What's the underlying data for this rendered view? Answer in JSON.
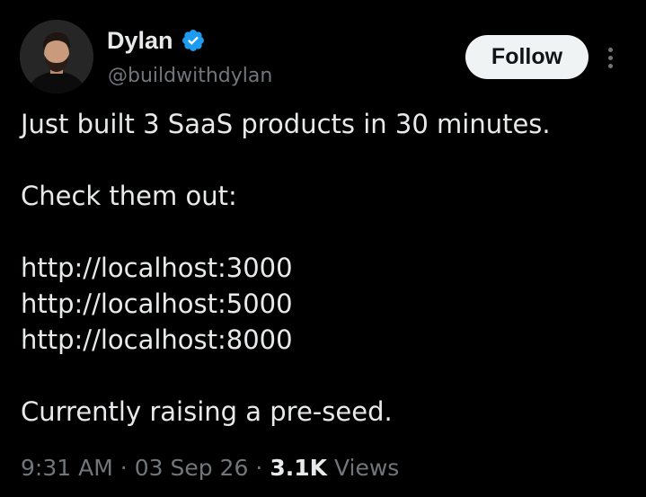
{
  "author": {
    "display_name": "Dylan",
    "handle": "@buildwithdylan",
    "verified": true,
    "verified_color": "#1d9bf0"
  },
  "actions": {
    "follow_label": "Follow",
    "more_icon": "more-vertical-icon"
  },
  "post": {
    "lines": [
      "Just built 3 SaaS products in 30 minutes.",
      "",
      "Check them out:",
      "",
      "http://localhost:3000",
      "http://localhost:5000",
      "http://localhost:8000",
      "",
      "Currently raising a pre-seed."
    ]
  },
  "meta": {
    "time": "9:31 AM",
    "separator": "·",
    "date": "03 Sep 26",
    "views_count": "3.1K",
    "views_label": "Views"
  },
  "colors": {
    "background": "#000000",
    "primary_text": "#e7e9ea",
    "secondary_text": "#71767b",
    "follow_button_bg": "#eff3f4"
  }
}
